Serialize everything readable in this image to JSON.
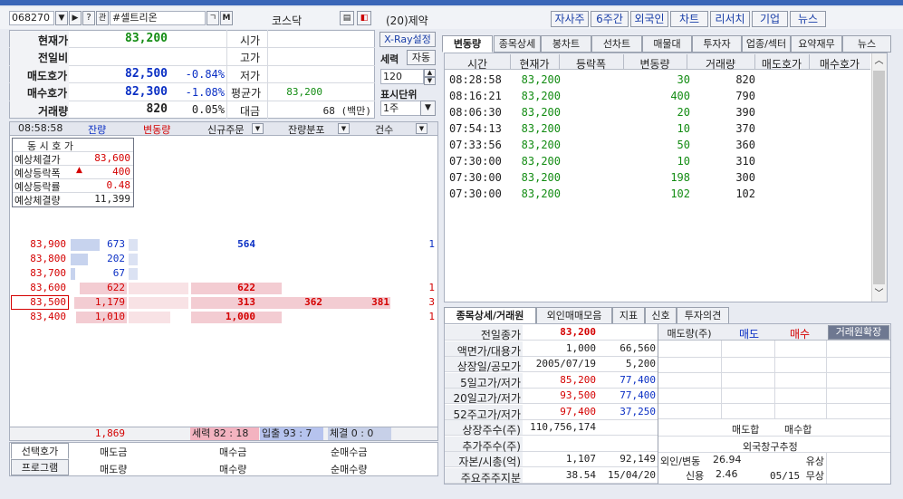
{
  "top": {
    "code": "068270",
    "name": "#셀트리온",
    "market": "코스닥",
    "sector": "(20)제약",
    "nav_buttons": [
      "자사주",
      "6주간",
      "외국인",
      "차트",
      "리서치",
      "기업",
      "뉴스"
    ]
  },
  "quote": {
    "labels": {
      "current": "현재가",
      "prev_diff": "전일비",
      "ask": "매도호가",
      "bid": "매수호가",
      "volume": "거래량"
    },
    "current": "83,200",
    "ask": "82,500",
    "ask_pct": "-0.84%",
    "bid": "82,300",
    "bid_pct": "-1.08%",
    "volume": "820",
    "volume_pct": "0.05%",
    "right_labels": {
      "open": "시가",
      "high": "고가",
      "low": "저가",
      "avg": "평균가",
      "amount": "대금"
    },
    "avg": "83,200",
    "amount": "68 (백만)"
  },
  "side_panel": {
    "xray": "X-Ray설정",
    "force": "세력",
    "auto": "자동",
    "count": "120",
    "unit_label": "표시단위",
    "unit_value": "1주"
  },
  "orderbook": {
    "time": "08:58:58",
    "headers": [
      "잔량",
      "변동량",
      "신규주문",
      "잔량분포",
      "건수"
    ],
    "expected_title": "동 시 호 가",
    "expected": [
      {
        "label": "예상체결가",
        "value": "83,600"
      },
      {
        "label": "예상등락폭",
        "value": "400"
      },
      {
        "label": "예상등락률",
        "value": "0.48"
      },
      {
        "label": "예상체결량",
        "value": "11,399"
      }
    ],
    "rows": [
      {
        "price": "83,900",
        "qty": "673",
        "mid": "564",
        "count": "1",
        "bar": 0.55
      },
      {
        "price": "83,800",
        "qty": "202",
        "mid": "",
        "count": "",
        "bar": 0.32
      },
      {
        "price": "83,700",
        "qty": "67",
        "mid": "",
        "count": "",
        "bar": 0.08
      },
      {
        "price": "83,600",
        "qty": "622",
        "mid": "622",
        "count": "1",
        "bar": 0.9
      },
      {
        "price": "83,500",
        "qty": "1,179",
        "mid": "313",
        "extra1": "362",
        "extra2": "381",
        "count": "3",
        "bar": 1.0
      },
      {
        "price": "83,400",
        "qty": "1,010",
        "mid": "1,000",
        "count": "1",
        "bar": 0.97
      }
    ],
    "footer_total": "1,869",
    "footer_force": "세력 82 : 18",
    "footer_inout": "입출 93 : 7",
    "footer_exec": "체결 0 : 0",
    "bottom_tabs": [
      "선택호가",
      "프로그램"
    ],
    "bottom_labels": [
      "매도금",
      "매수금",
      "순매수금",
      "매도량",
      "매수량",
      "순매수량"
    ]
  },
  "right_tabs": [
    "변동량",
    "종목상세",
    "봉차트",
    "선차트",
    "매물대",
    "투자자",
    "업종/섹터",
    "요약재무",
    "뉴스"
  ],
  "trades": {
    "headers": [
      "시간",
      "현재가",
      "등락폭",
      "변동량",
      "거래량",
      "매도호가",
      "매수호가"
    ],
    "rows": [
      [
        "08:28:58",
        "83,200",
        "",
        "30",
        "820"
      ],
      [
        "08:16:21",
        "83,200",
        "",
        "400",
        "790"
      ],
      [
        "08:06:30",
        "83,200",
        "",
        "20",
        "390"
      ],
      [
        "07:54:13",
        "83,200",
        "",
        "10",
        "370"
      ],
      [
        "07:33:56",
        "83,200",
        "",
        "50",
        "360"
      ],
      [
        "07:30:00",
        "83,200",
        "",
        "10",
        "310"
      ],
      [
        "07:30:00",
        "83,200",
        "",
        "198",
        "300"
      ],
      [
        "07:30:00",
        "83,200",
        "",
        "102",
        "102"
      ]
    ]
  },
  "bottom_tabs": [
    "종목상세/거래원",
    "외인매매모음",
    "지표",
    "신호",
    "투자의견"
  ],
  "detail": {
    "rows": [
      {
        "label": "전일종가",
        "v1": "83,200",
        "v2": ""
      },
      {
        "label": "액면가/대용가",
        "v1": "1,000",
        "v2": "66,560"
      },
      {
        "label": "상장일/공모가",
        "v1": "2005/07/19",
        "v2": "5,200"
      },
      {
        "label": "5일고가/저가",
        "v1": "85,200",
        "v2": "77,400"
      },
      {
        "label": "20일고가/저가",
        "v1": "93,500",
        "v2": "77,400"
      },
      {
        "label": "52주고가/저가",
        "v1": "97,400",
        "v2": "37,250"
      },
      {
        "label": "상장주수(주)",
        "v1": "110,756,174",
        "v2": ""
      },
      {
        "label": "추가주수(주)",
        "v1": "",
        "v2": ""
      },
      {
        "label": "자본/시총(억)",
        "v1": "1,107",
        "v2": "92,149"
      },
      {
        "label": "주요주주지분",
        "v1": "38.54",
        "v2": "15/04/20"
      }
    ],
    "broker_headers": [
      "매도량(주)",
      "매도",
      "매수",
      "거래원확장"
    ],
    "broker_footer": [
      "매도합",
      "매수합"
    ],
    "foreign_label": "외국창구추정",
    "foreign_row": {
      "label": "외인/변동",
      "v1": "26.94",
      "v2": "유상"
    },
    "credit_row": {
      "label": "신용",
      "v1": "2.46",
      "v2": "05/15 무상"
    }
  }
}
